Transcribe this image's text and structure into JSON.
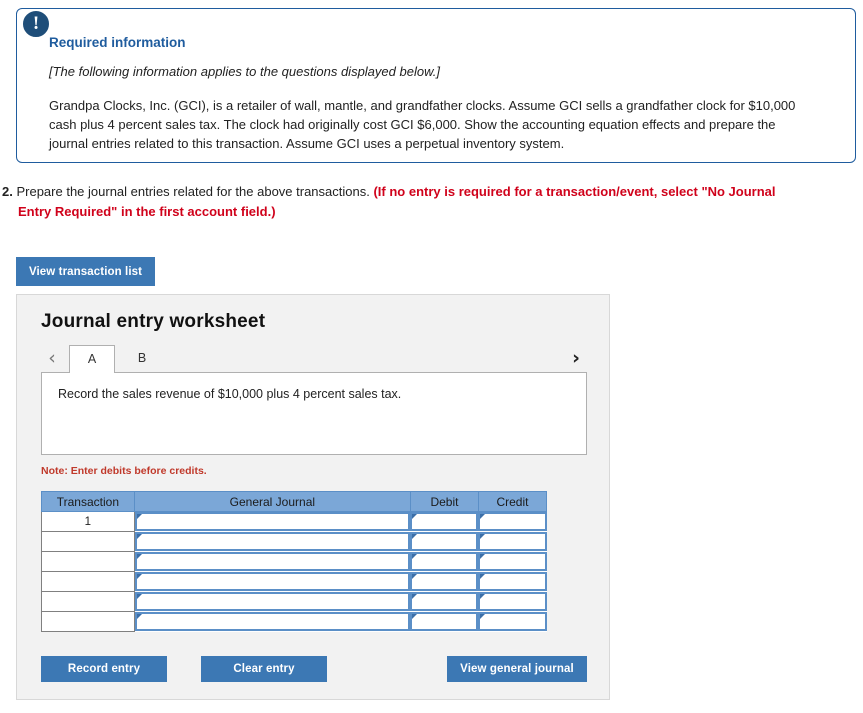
{
  "required_info": {
    "badge_icon": "exclamation-icon",
    "title": "Required information",
    "subtitle": "[The following information applies to the questions displayed below.]",
    "body": "Grandpa Clocks, Inc. (GCI), is a retailer of wall, mantle, and grandfather clocks. Assume GCI sells a grandfather clock for $10,000 cash plus 4 percent sales tax. The clock had originally cost GCI $6,000. Show the accounting equation effects and prepare the journal entries related to this transaction. Assume GCI uses a perpetual inventory system.",
    "border_color": "#1F5C9E",
    "badge_color": "#1F4E79"
  },
  "question": {
    "number": "2.",
    "text": "Prepare the journal entries related for the above transactions.",
    "emphasis_line1": "(If no entry is required for a transaction/event, select \"No Journal",
    "emphasis_line2": "Entry Required\" in the first account field.)",
    "emphasis_color": "#D0021B"
  },
  "buttons": {
    "view_transaction_list": "View transaction list",
    "record_entry": "Record entry",
    "clear_entry": "Clear entry",
    "view_general_journal": "View general journal",
    "primary_color": "#3C78B4"
  },
  "worksheet": {
    "title": "Journal entry worksheet",
    "prev_arrow": "‹",
    "next_arrow": "›",
    "tabs": [
      {
        "label": "A",
        "active": true
      },
      {
        "label": "B",
        "active": false
      }
    ],
    "description": "Record the sales revenue of $10,000 plus 4 percent sales tax.",
    "note": "Note: Enter debits before credits.",
    "note_color": "#C0392B",
    "table": {
      "header_color": "#7BA7D7",
      "columns": [
        "Transaction",
        "General Journal",
        "Debit",
        "Credit"
      ],
      "rows": [
        {
          "transaction": "1",
          "general_journal": "",
          "debit": "",
          "credit": ""
        },
        {
          "transaction": "",
          "general_journal": "",
          "debit": "",
          "credit": ""
        },
        {
          "transaction": "",
          "general_journal": "",
          "debit": "",
          "credit": ""
        },
        {
          "transaction": "",
          "general_journal": "",
          "debit": "",
          "credit": ""
        },
        {
          "transaction": "",
          "general_journal": "",
          "debit": "",
          "credit": ""
        },
        {
          "transaction": "",
          "general_journal": "",
          "debit": "",
          "credit": ""
        }
      ]
    }
  }
}
